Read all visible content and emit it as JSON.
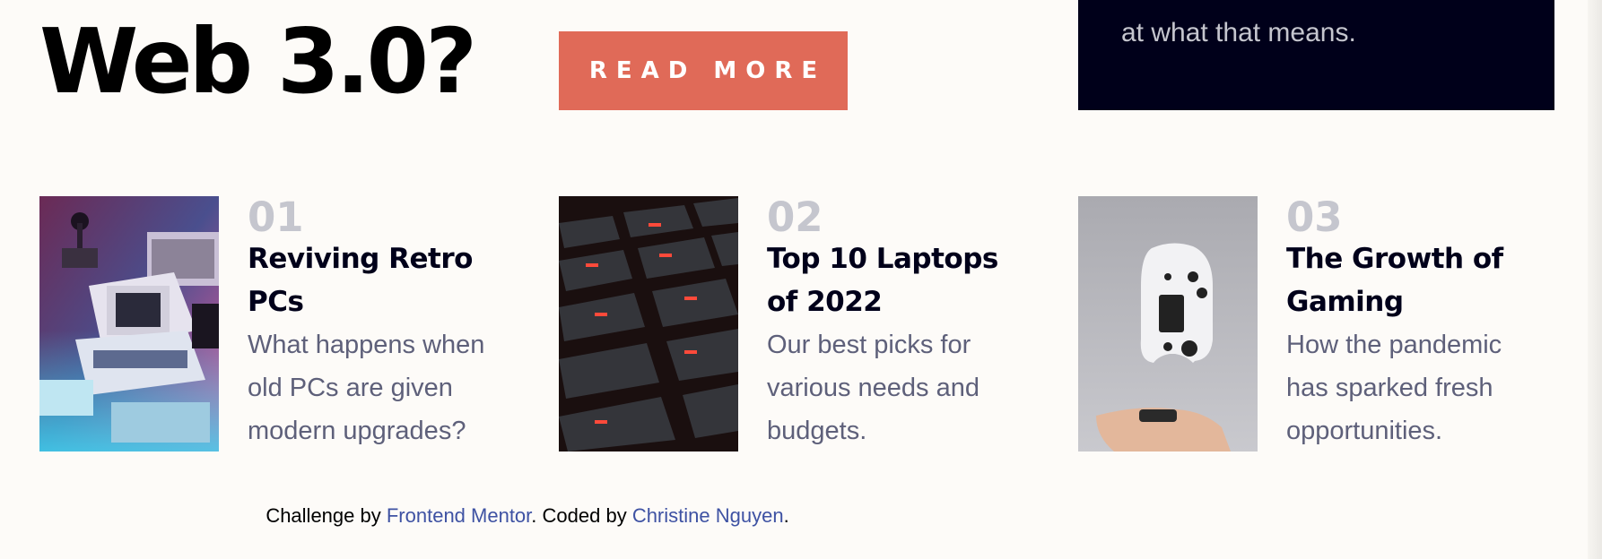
{
  "hero": {
    "headline": "Web 3.0?",
    "read_more_label": "READ MORE",
    "panel_text": "at what that means."
  },
  "articles": [
    {
      "number": "01",
      "title": "Reviving Retro PCs",
      "description": "What happens when old PCs are given modern upgrades?",
      "image_icon": "retro-pc-image"
    },
    {
      "number": "02",
      "title": "Top 10 Laptops of 2022",
      "description": "Our best picks for various needs and budgets.",
      "image_icon": "laptop-keyboard-image"
    },
    {
      "number": "03",
      "title": "The Growth of Gaming",
      "description": "How the pandemic has sparked fresh opportunities.",
      "image_icon": "game-controller-image"
    }
  ],
  "footer": {
    "prefix": "Challenge by ",
    "link1": "Frontend Mentor",
    "middle": ". Coded by ",
    "link2": "Christine Nguyen",
    "suffix": "."
  },
  "colors": {
    "accent": "#e06a58",
    "dark_panel": "#00001a",
    "muted_number": "#c5c6ce",
    "body_text": "#5e607a",
    "link": "#3e52a3",
    "background": "#fdfbf8"
  }
}
